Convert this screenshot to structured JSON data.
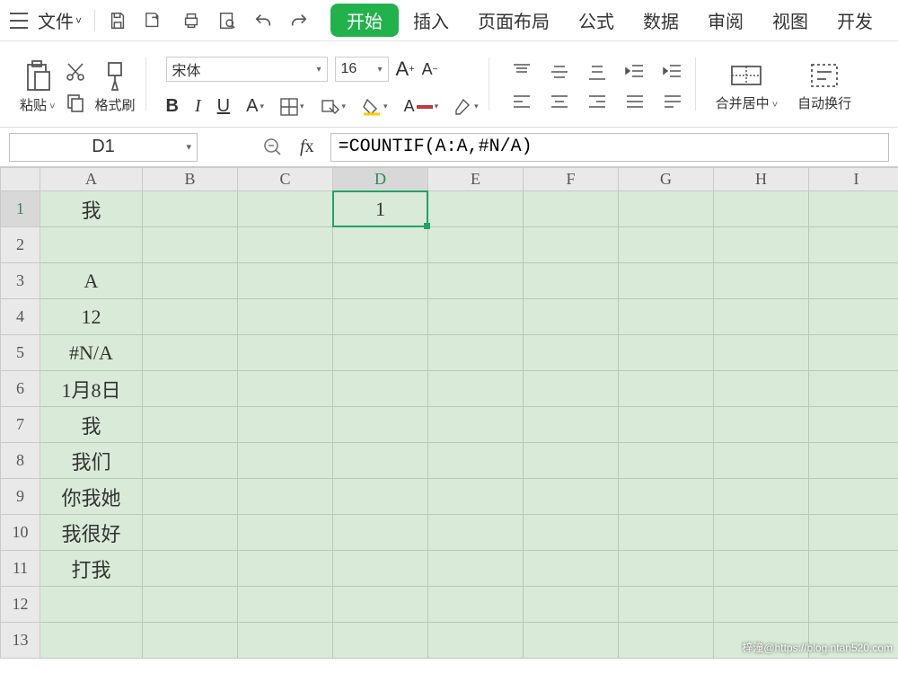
{
  "menu": {
    "file": "文件",
    "tabs": [
      "开始",
      "插入",
      "页面布局",
      "公式",
      "数据",
      "审阅",
      "视图",
      "开发"
    ],
    "active_tab_index": 0
  },
  "ribbon": {
    "paste": "粘贴",
    "format_painter": "格式刷",
    "font_name": "宋体",
    "font_size": "16",
    "merge_center": "合并居中",
    "wrap_text": "自动换行"
  },
  "name_box": "D1",
  "formula": "=COUNTIF(A:A,#N/A)",
  "fx_label": "fx",
  "columns": [
    "A",
    "B",
    "C",
    "D",
    "E",
    "F",
    "G",
    "H",
    "I"
  ],
  "selected_col": "D",
  "selected_row": 1,
  "rows": [
    {
      "n": 1,
      "A": "我",
      "D": "1"
    },
    {
      "n": 2
    },
    {
      "n": 3,
      "A": "A"
    },
    {
      "n": 4,
      "A": "12"
    },
    {
      "n": 5,
      "A": "#N/A"
    },
    {
      "n": 6,
      "A": "1月8日"
    },
    {
      "n": 7,
      "A": "我"
    },
    {
      "n": 8,
      "A": "我们"
    },
    {
      "n": 9,
      "A": "你我她"
    },
    {
      "n": 10,
      "A": "我很好"
    },
    {
      "n": 11,
      "A": "打我"
    },
    {
      "n": 12
    },
    {
      "n": 13
    }
  ],
  "watermark": "梓潼@https://blog.ntan520.com"
}
